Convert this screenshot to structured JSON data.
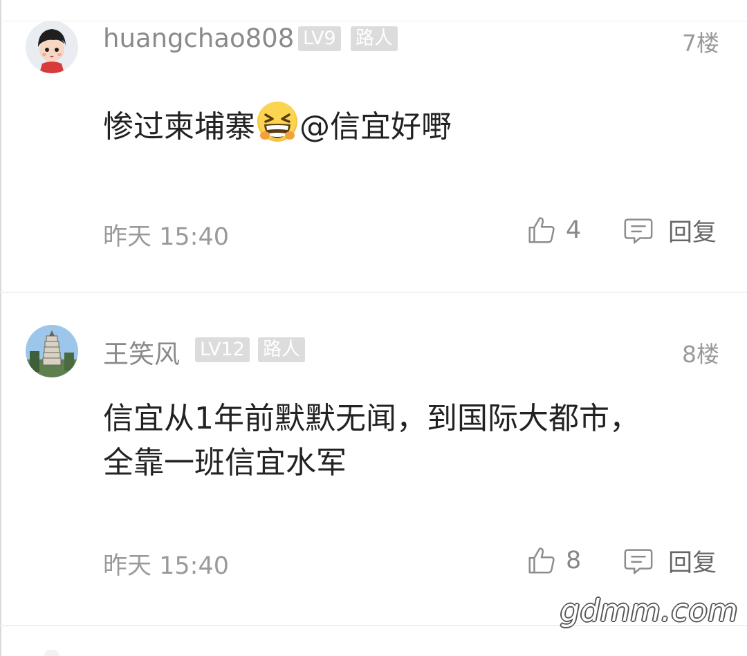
{
  "comments": [
    {
      "username": "huangchao808",
      "level_badge": "LV9",
      "role_badge": "路人",
      "floor": "7楼",
      "text_before_emoji": "惨过柬埔寨",
      "emoji": "grinning-squint-emoji",
      "text_after_emoji": "@信宜好嘢",
      "time": "昨天 15:40",
      "likes": "4",
      "reply_label": "回复"
    },
    {
      "username": "王笑风",
      "level_badge": "LV12",
      "role_badge": "路人",
      "floor": "8楼",
      "text": "信宜从1年前默默无闻，到国际大都市，全靠一班信宜水军",
      "time": "昨天 15:40",
      "likes": "8",
      "reply_label": "回复"
    }
  ],
  "icons": {
    "like": "thumbs-up-icon",
    "reply": "comment-bubble-icon"
  },
  "watermark": "gdmm.com",
  "colors": {
    "text_primary": "#222222",
    "text_secondary": "#8a8a8a",
    "badge_bg": "#dcdcdc"
  }
}
